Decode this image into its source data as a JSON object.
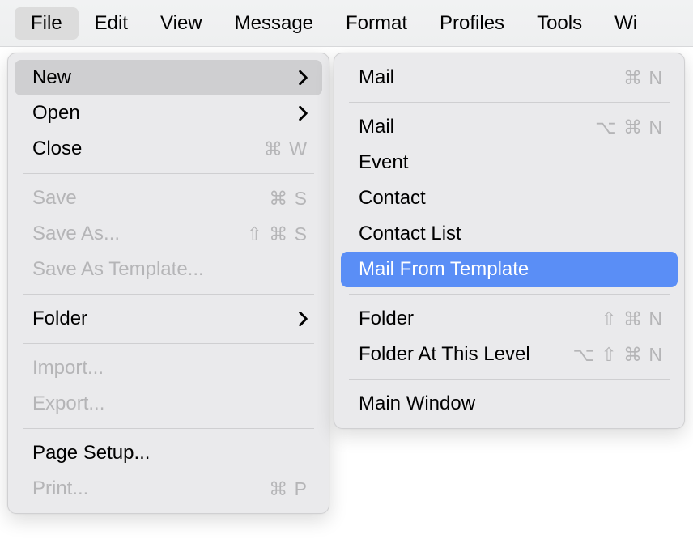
{
  "menubar": {
    "items": [
      {
        "label": "File",
        "active": true
      },
      {
        "label": "Edit"
      },
      {
        "label": "View"
      },
      {
        "label": "Message"
      },
      {
        "label": "Format"
      },
      {
        "label": "Profiles"
      },
      {
        "label": "Tools"
      },
      {
        "label": "Wi"
      }
    ]
  },
  "file_menu": {
    "items": [
      {
        "label": "New",
        "submenu": true,
        "hover": true
      },
      {
        "label": "Open",
        "submenu": true
      },
      {
        "label": "Close",
        "shortcut": "⌘ W"
      },
      {
        "sep": true
      },
      {
        "label": "Save",
        "shortcut": "⌘ S",
        "disabled": true
      },
      {
        "label": "Save As...",
        "shortcut": "⇧ ⌘ S",
        "disabled": true
      },
      {
        "label": "Save As Template...",
        "disabled": true
      },
      {
        "sep": true
      },
      {
        "label": "Folder",
        "submenu": true
      },
      {
        "sep": true
      },
      {
        "label": "Import...",
        "disabled": true
      },
      {
        "label": "Export...",
        "disabled": true
      },
      {
        "sep": true
      },
      {
        "label": "Page Setup..."
      },
      {
        "label": "Print...",
        "shortcut": "⌘ P",
        "disabled": true
      }
    ]
  },
  "submenu_new": {
    "items": [
      {
        "label": "Mail",
        "shortcut": "⌘ N"
      },
      {
        "sep": true
      },
      {
        "label": "Mail",
        "shortcut": "⌥ ⌘ N"
      },
      {
        "label": "Event"
      },
      {
        "label": "Contact"
      },
      {
        "label": "Contact List"
      },
      {
        "label": "Mail From Template",
        "highlight": true
      },
      {
        "sep": true
      },
      {
        "label": "Folder",
        "shortcut": "⇧ ⌘ N"
      },
      {
        "label": "Folder At This Level",
        "shortcut": "⌥ ⇧ ⌘ N"
      },
      {
        "sep": true
      },
      {
        "label": "Main Window"
      }
    ]
  }
}
